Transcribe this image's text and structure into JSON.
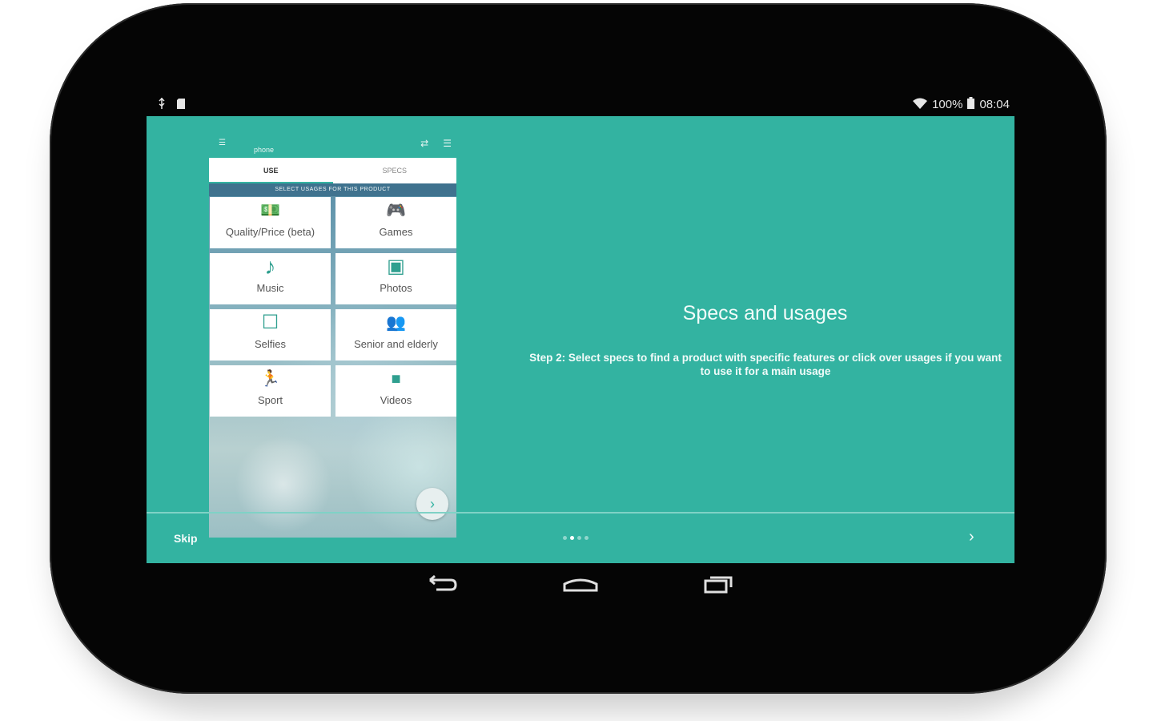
{
  "statusbar": {
    "battery": "100%",
    "time": "08:04",
    "icons": [
      "usb-icon",
      "sdcard-icon",
      "wifi-icon",
      "battery-icon"
    ]
  },
  "mock": {
    "title": "phone",
    "tabs": [
      {
        "label": "USE",
        "active": true
      },
      {
        "label": "SPECS",
        "active": false
      }
    ],
    "section_label": "SELECT USAGES FOR THIS PRODUCT",
    "tiles": [
      {
        "label": "Quality/Price (beta)",
        "icon": "money-icon",
        "glyph": "💵"
      },
      {
        "label": "Games",
        "icon": "gamepad-icon",
        "glyph": "🎮"
      },
      {
        "label": "Music",
        "icon": "music-note-icon",
        "glyph": "♪"
      },
      {
        "label": "Photos",
        "icon": "photo-icon",
        "glyph": "▣"
      },
      {
        "label": "Selfies",
        "icon": "selfie-icon",
        "glyph": "☐"
      },
      {
        "label": "Senior and elderly",
        "icon": "people-icon",
        "glyph": "👥"
      },
      {
        "label": "Sport",
        "icon": "runner-icon",
        "glyph": "🏃"
      },
      {
        "label": "Videos",
        "icon": "videocam-icon",
        "glyph": "■"
      }
    ]
  },
  "onboarding": {
    "headline": "Specs and usages",
    "description": "Step 2: Select specs to find a product with specific features or click over usages if you want to use it for a main usage",
    "skip_label": "Skip",
    "page_count": 4,
    "current_page": 2
  },
  "colors": {
    "accent": "#33b3a1",
    "bezel": "#050505"
  }
}
